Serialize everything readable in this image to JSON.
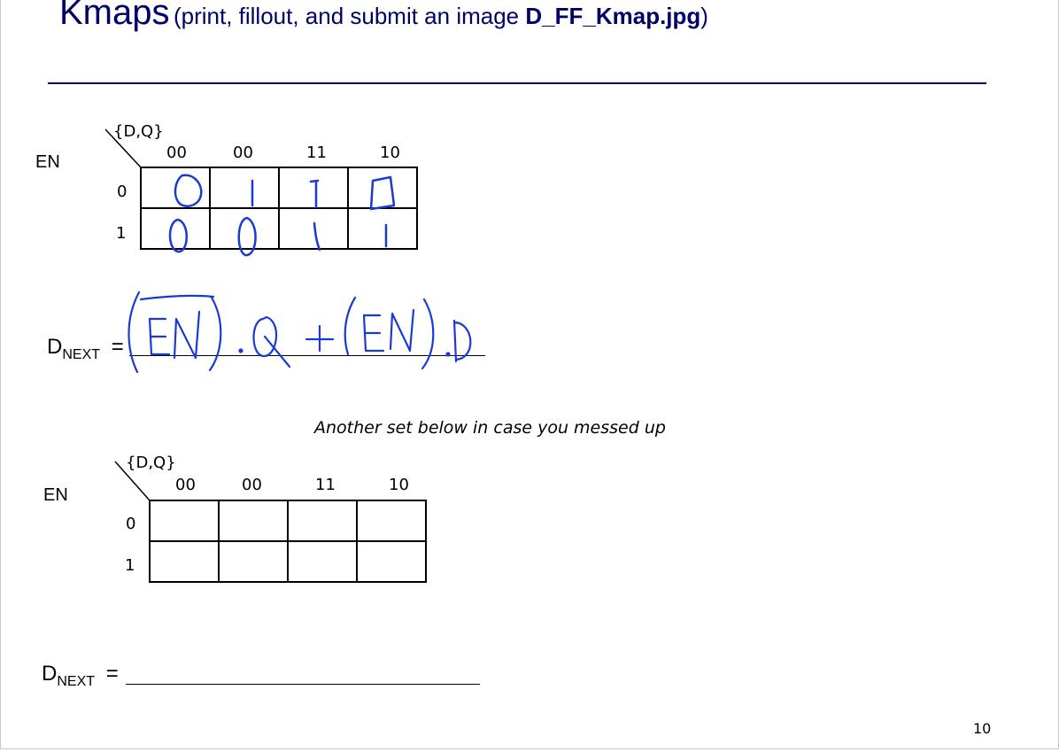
{
  "title": {
    "main": "Kmaps",
    "paren_open": "(print, fillout, and submit an image ",
    "filename": "D_FF_Kmap.jpg",
    "paren_close": ")"
  },
  "kmap1": {
    "corner_label": "{D,Q}",
    "row_var": "EN",
    "col_headers": [
      "00",
      "00",
      "11",
      "10"
    ],
    "row_headers": [
      "0",
      "1"
    ],
    "cells_handwritten": [
      [
        "0",
        "1",
        "1",
        "0"
      ],
      [
        "0",
        "0",
        "1",
        "1"
      ]
    ]
  },
  "equation1": {
    "lhs_main": "D",
    "lhs_sub": "NEXT",
    "equals": "=",
    "handwritten_answer": "(EN).Q + (EN).D"
  },
  "note": "Another set below in case you messed up",
  "kmap2": {
    "corner_label": "{D,Q}",
    "row_var": "EN",
    "col_headers": [
      "00",
      "00",
      "11",
      "10"
    ],
    "row_headers": [
      "0",
      "1"
    ]
  },
  "equation2": {
    "lhs_main": "D",
    "lhs_sub": "NEXT",
    "equals": "="
  },
  "page_number": "10",
  "colors": {
    "title": "#000066",
    "rule": "#000099",
    "ink": "#1a3ad6"
  }
}
